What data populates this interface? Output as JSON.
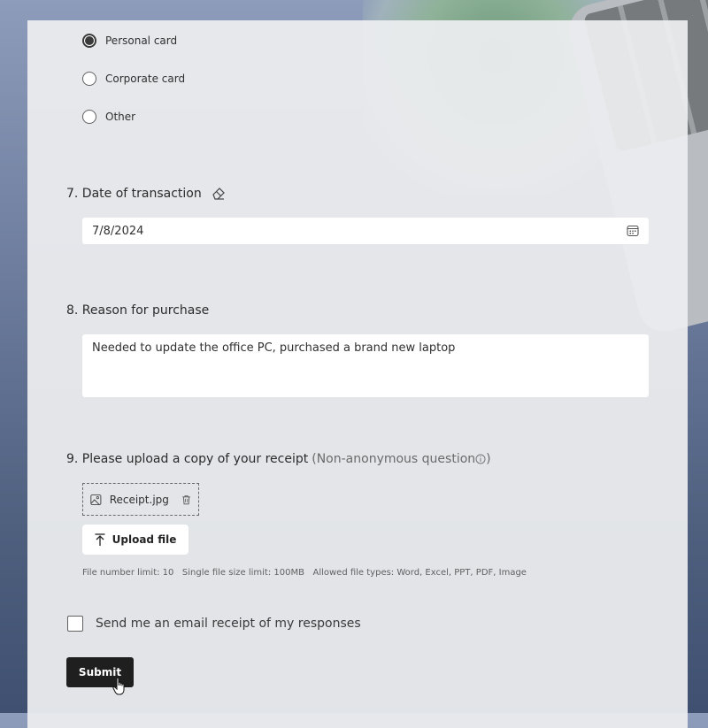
{
  "payment_method": {
    "options": [
      {
        "label": "Personal card",
        "checked": true
      },
      {
        "label": "Corporate card",
        "checked": false
      },
      {
        "label": "Other",
        "checked": false
      }
    ]
  },
  "q7": {
    "title": "7. Date of transaction",
    "value": "7/8/2024",
    "clear_icon": "eraser-icon",
    "calendar_icon": "calendar-icon"
  },
  "q8": {
    "title": "8. Reason for purchase",
    "value": "Needed to update the office PC, purchased a brand new laptop"
  },
  "q9": {
    "title": "9. Please upload a copy of your receipt",
    "note": "(Non-anonymous question",
    "note_end": ")",
    "file_name": "Receipt.jpg",
    "upload_label": "Upload file",
    "limits": "File number limit: 10   Single file size limit: 100MB   Allowed file types: Word, Excel, PPT, PDF, Image"
  },
  "email_receipt": {
    "label": "Send me an email receipt of my responses",
    "checked": false
  },
  "submit": {
    "label": "Submit"
  }
}
